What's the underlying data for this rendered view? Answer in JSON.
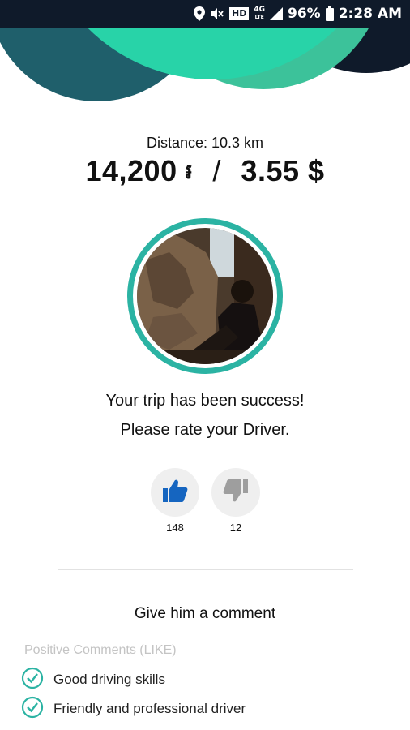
{
  "status_bar": {
    "hd": "HD",
    "network": "4G",
    "network_sub": "LTE",
    "battery": "96%",
    "time": "2:28 AM"
  },
  "trip": {
    "distance_text": "Distance: 10.3 km",
    "fare_riel": "14,200",
    "riel_symbol": "៛",
    "separator": "/",
    "fare_usd": "3.55 $"
  },
  "message": {
    "line1": "Your trip has been success!",
    "line2": "Please rate your Driver."
  },
  "rating": {
    "like_count": "148",
    "dislike_count": "12"
  },
  "comments": {
    "title": "Give him a comment",
    "section_label": "Positive Comments (LIKE)",
    "items": [
      {
        "label": "Good driving skills"
      },
      {
        "label": "Friendly and professional driver"
      }
    ]
  },
  "colors": {
    "accent_teal": "#2bb3a3",
    "like_blue": "#1565c0",
    "dislike_grey": "#9e9e9e",
    "header_dark": "#0f1a2a"
  }
}
